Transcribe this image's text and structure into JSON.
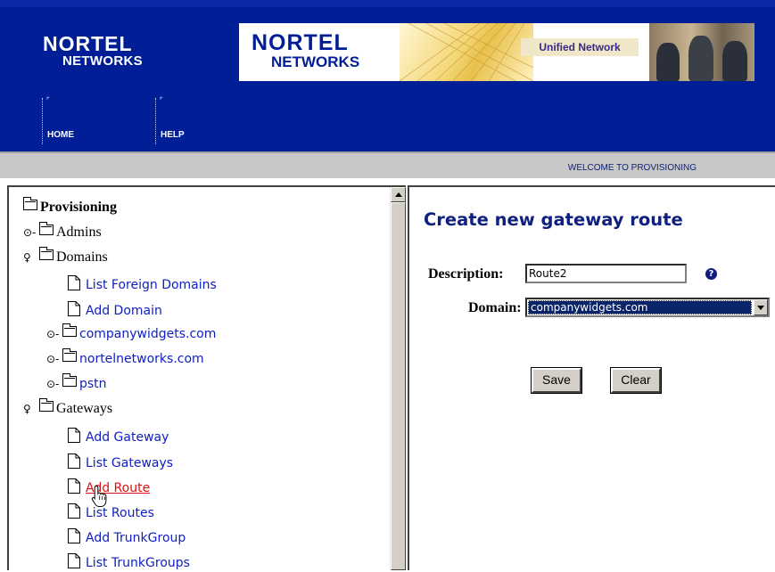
{
  "header": {
    "logo_line1": "NORTEL",
    "logo_line2": "NETWORKS",
    "banner_logo_line1": "NORTEL",
    "banner_logo_line2": "NETWORKS",
    "banner_tagline": "Unified Network",
    "nav": [
      {
        "label": "HOME"
      },
      {
        "label": "HELP"
      }
    ],
    "welcome": "WELCOME TO PROVISIONING"
  },
  "tree": {
    "root": "Provisioning",
    "admins": "Admins",
    "domains": "Domains",
    "domain_links": [
      "List Foreign Domains",
      "Add Domain"
    ],
    "domain_folders": [
      "companywidgets.com",
      "nortelnetworks.com",
      "pstn"
    ],
    "gateways": "Gateways",
    "gateway_links": [
      "Add Gateway",
      "List Gateways",
      "Add Route",
      "List Routes",
      "Add TrunkGroup",
      "List TrunkGroups"
    ]
  },
  "form": {
    "title": "Create new gateway route",
    "description_label": "Description:",
    "description_value": "Route2",
    "domain_label": "Domain:",
    "domain_value": "companywidgets.com",
    "save_label": "Save",
    "clear_label": "Clear",
    "help_glyph": "?"
  },
  "colors": {
    "header_blue": "#001e96",
    "link_blue": "#1020c0",
    "active_link": "#e01010",
    "title_blue": "#102080"
  }
}
